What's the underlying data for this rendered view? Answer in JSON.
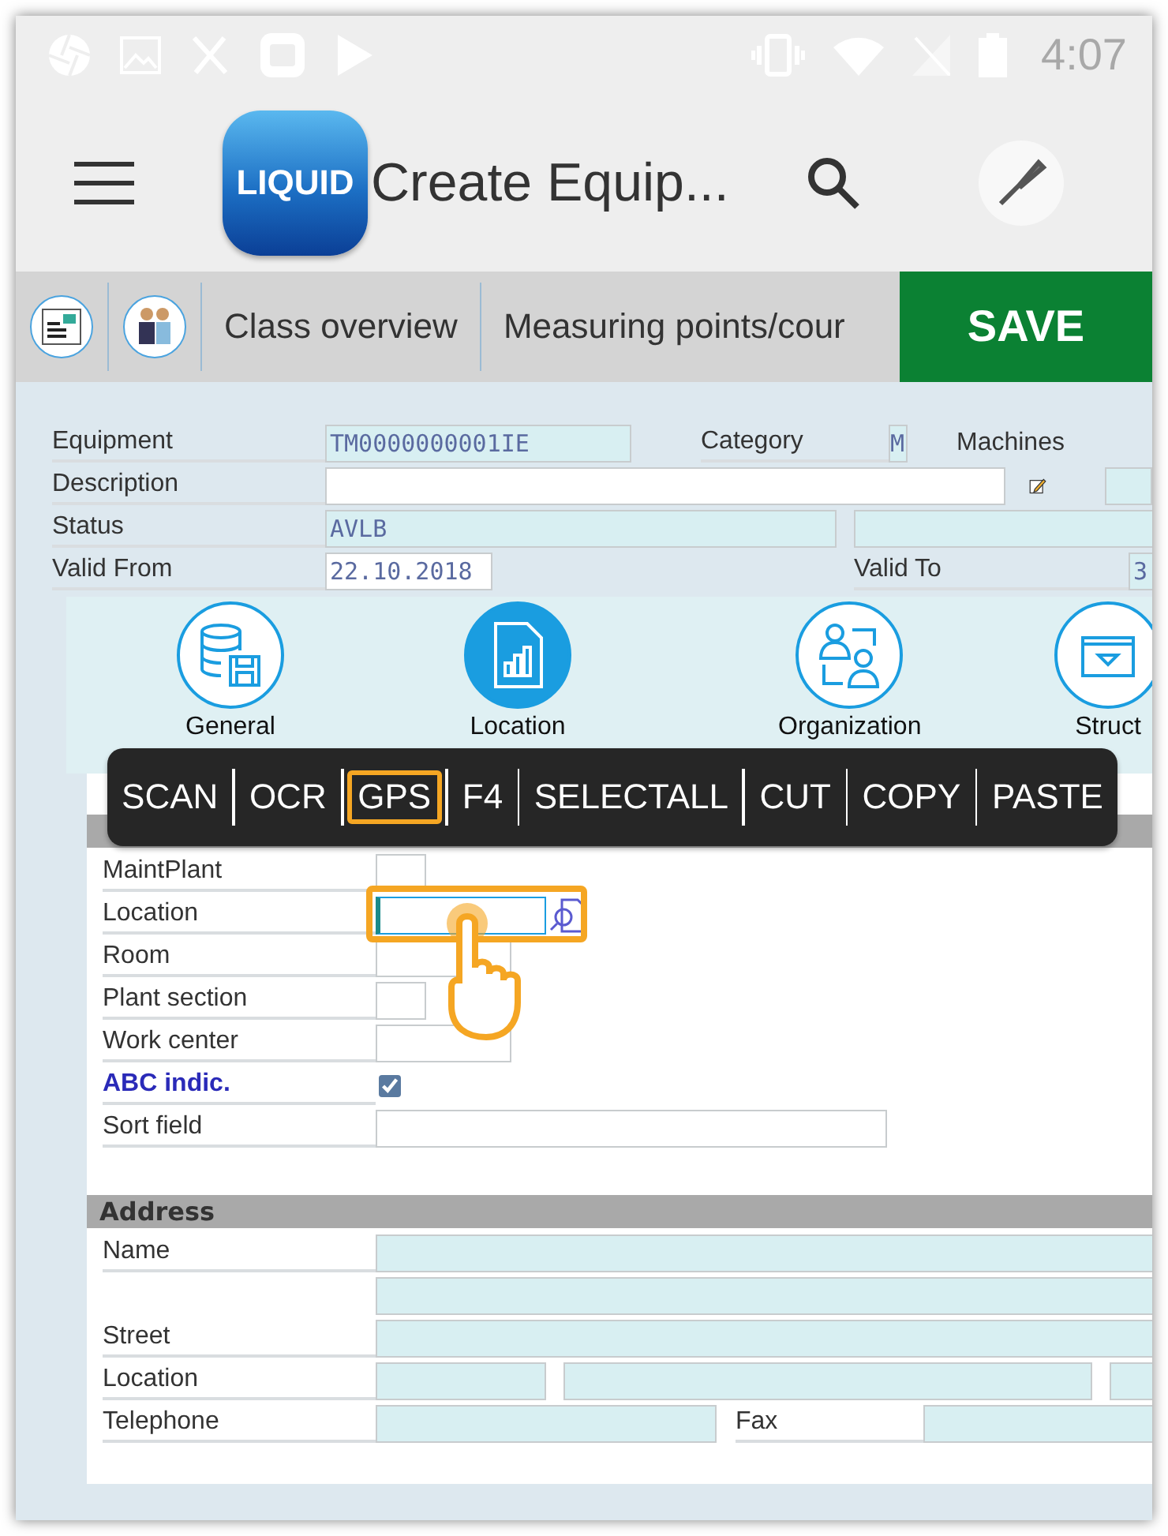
{
  "status_bar": {
    "time": "4:07"
  },
  "app_bar": {
    "logo": "LIQUID",
    "title": "Create Equip..."
  },
  "toolbar": {
    "items": [
      {
        "kind": "icon"
      },
      {
        "kind": "icon"
      },
      {
        "kind": "text",
        "label": "Class overview"
      },
      {
        "kind": "text",
        "label": "Measuring points/cour"
      }
    ],
    "save": "SAVE"
  },
  "header": {
    "equipment": {
      "label": "Equipment",
      "value": "TM0000000001IE"
    },
    "category": {
      "label": "Category",
      "value": "M",
      "text": "Machines"
    },
    "description": {
      "label": "Description"
    },
    "status": {
      "label": "Status",
      "value": "AVLB"
    },
    "valid_from": {
      "label": "Valid From",
      "value": "22.10.2018"
    },
    "valid_to": {
      "label": "Valid To",
      "value": "3"
    }
  },
  "tabs": [
    {
      "label": "General",
      "selected": false
    },
    {
      "label": "Location",
      "selected": true
    },
    {
      "label": "Organization",
      "selected": false
    },
    {
      "label": "Struct",
      "selected": false
    }
  ],
  "context_menu": [
    {
      "label": "SCAN",
      "selected": false
    },
    {
      "label": "OCR",
      "selected": false
    },
    {
      "label": "GPS",
      "selected": true
    },
    {
      "label": "F4",
      "selected": false
    },
    {
      "label": "SELECTALL",
      "selected": false
    },
    {
      "label": "CUT",
      "selected": false
    },
    {
      "label": "COPY",
      "selected": false
    },
    {
      "label": "PASTE",
      "selected": false
    }
  ],
  "location_section": {
    "rows": [
      {
        "label": "MaintPlant",
        "kind": "short",
        "highlight": false
      },
      {
        "label": "Location",
        "kind": "search",
        "highlight": false
      },
      {
        "label": "Room",
        "kind": "medium",
        "highlight": false
      },
      {
        "label": "Plant section",
        "kind": "short",
        "highlight": false
      },
      {
        "label": "Work center",
        "kind": "medium",
        "highlight": false
      },
      {
        "label": "ABC indic.",
        "kind": "checkbox",
        "checked": true,
        "highlight": true
      },
      {
        "label": "Sort field",
        "kind": "long",
        "highlight": false
      }
    ]
  },
  "address_section": {
    "title": "Address",
    "rows": [
      {
        "label": "Name",
        "kind": "full"
      },
      {
        "label": "",
        "kind": "full"
      },
      {
        "label": "Street",
        "kind": "full"
      },
      {
        "label": "Location",
        "kind": "triple"
      },
      {
        "label": "Telephone",
        "kind": "phone",
        "second_label": "Fax"
      }
    ]
  }
}
